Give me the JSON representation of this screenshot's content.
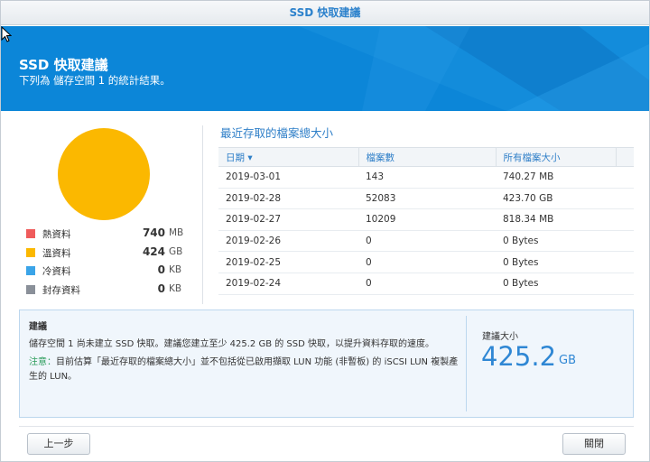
{
  "window": {
    "title": "SSD 快取建議"
  },
  "banner": {
    "title": "SSD 快取建議",
    "subtitle": "下列為 儲存空間 1 的統計結果。"
  },
  "colors": {
    "hot": "#ef5b5b",
    "warm": "#fbb800",
    "cold": "#3aa4e8",
    "archive": "#8a9099",
    "accent": "#2f87d4"
  },
  "pie": {
    "hot_fraction": 0.0,
    "warm_fraction": 1.0,
    "cold_fraction": 0.0,
    "archive_fraction": 0.0
  },
  "legend": [
    {
      "label": "熱資料",
      "value": "740",
      "unit": "MB",
      "color_key": "hot"
    },
    {
      "label": "溫資料",
      "value": "424",
      "unit": "GB",
      "color_key": "warm"
    },
    {
      "label": "冷資料",
      "value": "0",
      "unit": "KB",
      "color_key": "cold"
    },
    {
      "label": "封存資料",
      "value": "0",
      "unit": "KB",
      "color_key": "archive"
    }
  ],
  "table": {
    "title": "最近存取的檔案總大小",
    "headers": {
      "date": "日期",
      "sort_icon": "▾",
      "count": "檔案數",
      "size": "所有檔案大小"
    },
    "rows": [
      {
        "date": "2019-03-01",
        "count": "143",
        "size": "740.27 MB"
      },
      {
        "date": "2019-02-28",
        "count": "52083",
        "size": "423.70 GB"
      },
      {
        "date": "2019-02-27",
        "count": "10209",
        "size": "818.34 MB"
      },
      {
        "date": "2019-02-26",
        "count": "0",
        "size": "0 Bytes"
      },
      {
        "date": "2019-02-25",
        "count": "0",
        "size": "0 Bytes"
      },
      {
        "date": "2019-02-24",
        "count": "0",
        "size": "0 Bytes"
      }
    ]
  },
  "advice": {
    "heading": "建議",
    "body": "儲存空間 1 尚未建立 SSD 快取。建議您建立至少 425.2 GB 的 SSD 快取，以提升資料存取的速度。",
    "note_label": "注意：",
    "note_text": "目前估算「最近存取的檔案總大小」並不包括從已啟用擷取 LUN 功能 (非暫板) 的 iSCSI LUN 複製產生的 LUN。",
    "recommended_label": "建議大小",
    "recommended_value": "425.2",
    "recommended_unit": "GB"
  },
  "buttons": {
    "prev": "上一步",
    "close": "關閉"
  }
}
